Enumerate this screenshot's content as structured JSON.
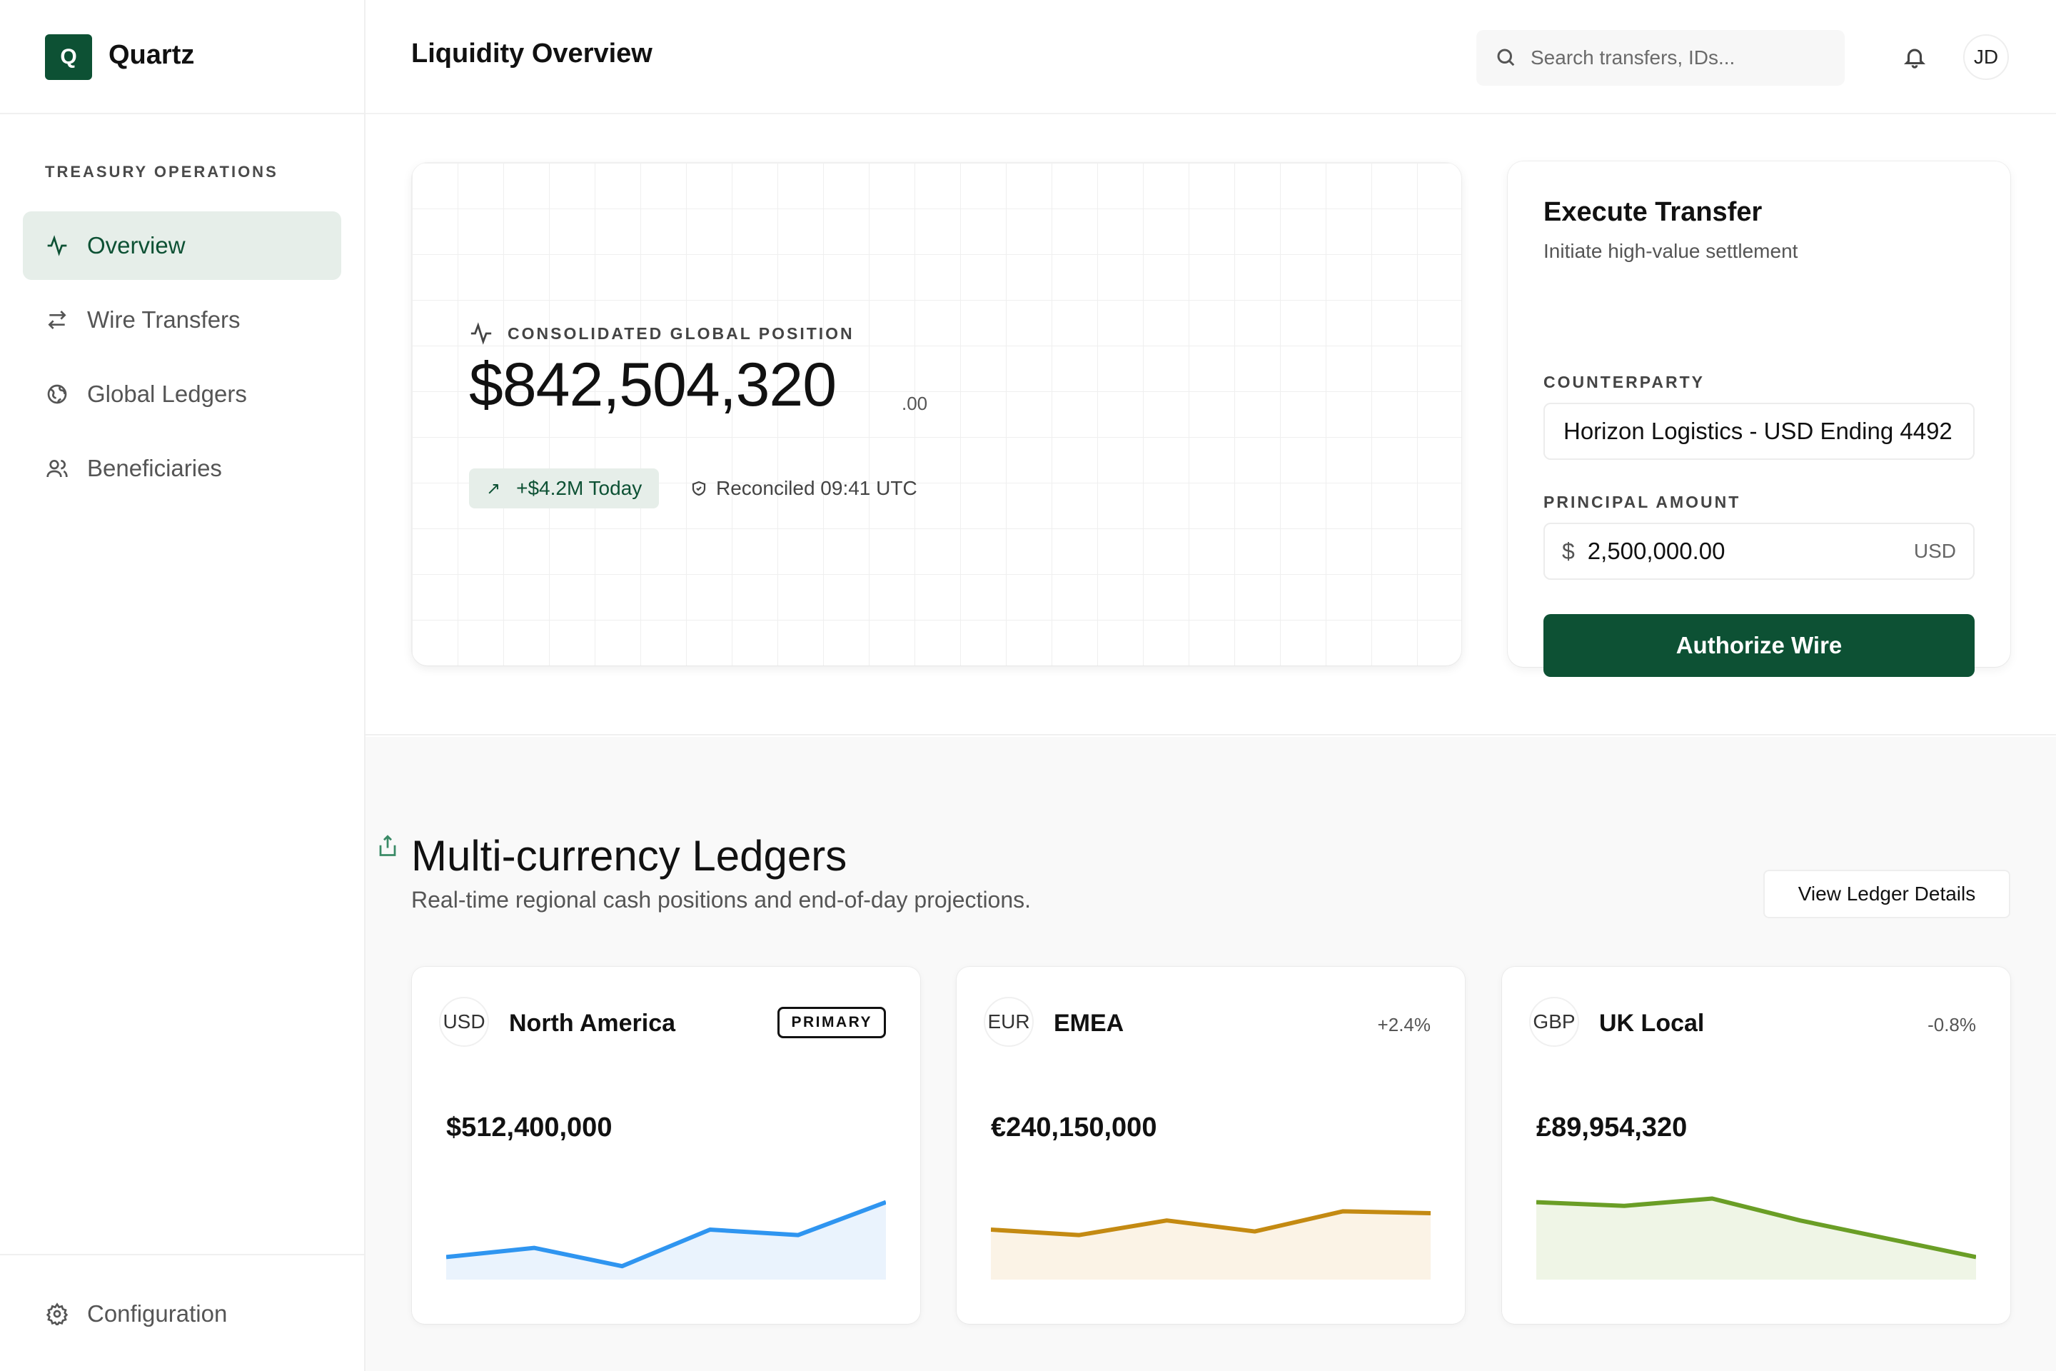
{
  "app": {
    "brand_initial": "Q",
    "brand_name": "Quartz"
  },
  "sidebar": {
    "section_title": "TREASURY OPERATIONS",
    "items": [
      {
        "label": "Overview",
        "icon": "activity-icon",
        "active": true
      },
      {
        "label": "Wire Transfers",
        "icon": "transfer-arrows-icon",
        "active": false
      },
      {
        "label": "Global Ledgers",
        "icon": "globe-icon",
        "active": false
      },
      {
        "label": "Beneficiaries",
        "icon": "users-icon",
        "active": false
      }
    ],
    "footer_item": {
      "label": "Configuration",
      "icon": "gear-icon"
    }
  },
  "header": {
    "title": "Liquidity Overview",
    "search_placeholder": "Search transfers, IDs...",
    "avatar_initials": "JD"
  },
  "position": {
    "label": "CONSOLIDATED GLOBAL POSITION",
    "amount": "$842,504,320",
    "cents": ".00",
    "change_badge": "+$4.2M Today",
    "reconciled": "Reconciled 09:41 UTC"
  },
  "transfer": {
    "title": "Execute Transfer",
    "subtitle": "Initiate high-value settlement",
    "counterparty_label": "COUNTERPARTY",
    "counterparty_value": "Horizon Logistics - USD Ending 4492",
    "amount_label": "PRINCIPAL AMOUNT",
    "amount_prefix": "$",
    "amount_value": "2,500,000.00",
    "amount_unit": "USD",
    "button_label": "Authorize Wire"
  },
  "ledgers": {
    "title": "Multi-currency Ledgers",
    "subtitle": "Real-time regional cash positions and end-of-day projections.",
    "view_button": "View Ledger Details",
    "cards": [
      {
        "code": "USD",
        "region": "North America",
        "tag": "PRIMARY",
        "change": "",
        "amount": "$512,400,000",
        "color": "#2f95f0",
        "fill": "#eaf3fd",
        "trend": [
          30,
          35,
          25,
          45,
          42,
          60
        ]
      },
      {
        "code": "EUR",
        "region": "EMEA",
        "tag": "",
        "change": "+2.4%",
        "amount": "€240,150,000",
        "color": "#c48a12",
        "fill": "#fbf3e6",
        "trend": [
          45,
          42,
          50,
          44,
          55,
          54
        ]
      },
      {
        "code": "GBP",
        "region": "UK Local",
        "tag": "",
        "change": "-0.8%",
        "amount": "£89,954,320",
        "color": "#6a9e26",
        "fill": "#eff5e6",
        "trend": [
          60,
          58,
          62,
          50,
          40,
          30
        ]
      }
    ]
  },
  "colors": {
    "brand": "#0d5134",
    "accent_bg": "#e6eee9"
  }
}
